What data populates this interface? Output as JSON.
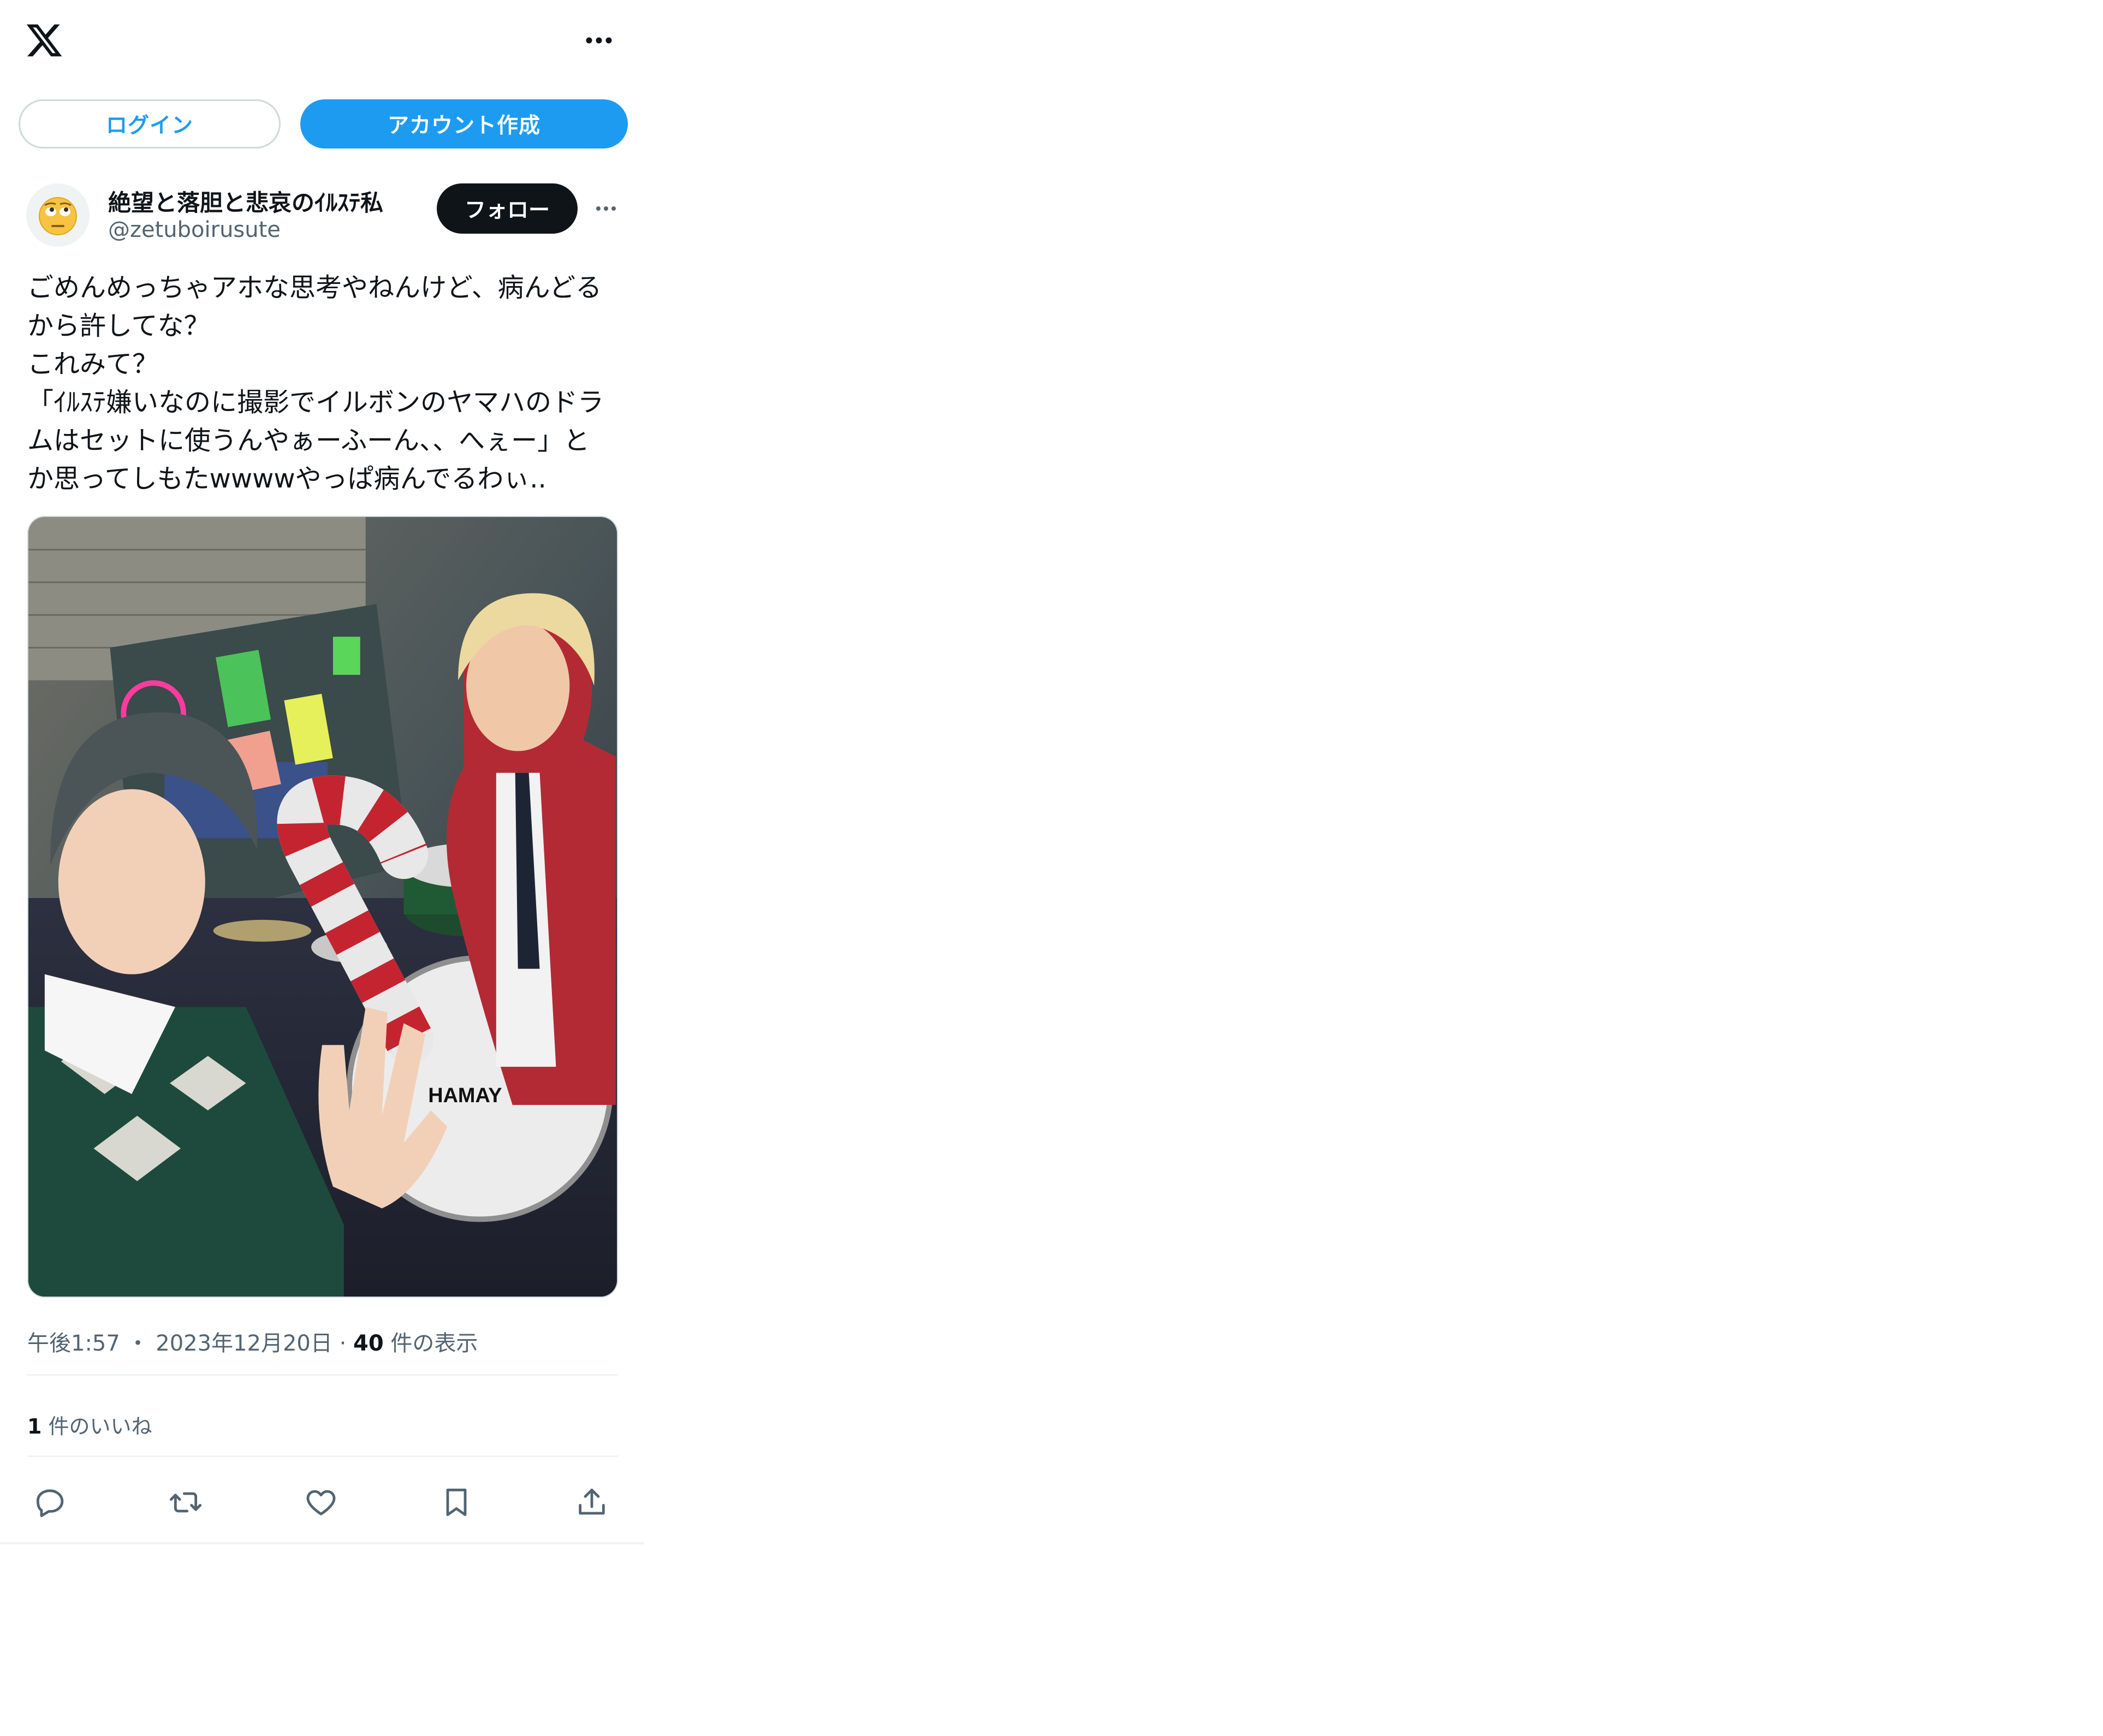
{
  "top_bar": {
    "logo_icon": "x-logo-icon",
    "more_icon": "more-horizontal-icon"
  },
  "auth": {
    "login_label": "ログイン",
    "signup_label": "アカウント作成"
  },
  "tweet": {
    "author_name": "絶望と落胆と悲哀のｲﾙｽﾃ私",
    "author_handle": "@zetuboirusute",
    "avatar_icon": "face-with-rolling-eyes-emoji",
    "follow_label": "フォロー",
    "text": "ごめんめっちゃアホな思考やねんけど、病んどる\nから許してな？\nこれみて？\n「ｲﾙｽﾃ嫌いなのに撮影でイルボンのヤマハのドラ\nムはセットに使うんやぁーふーん、、へぇー」と\nか思ってしもたwwwwやっぱ病んでるわぃ..",
    "photo_text": "HAMAY",
    "time": "午後1:57",
    "date": "2023年12月20日",
    "views_count": "40",
    "views_label": "件の表示",
    "likes_count": "1",
    "likes_label": "件のいいね"
  },
  "actions": [
    "reply-icon",
    "retweet-icon",
    "like-icon",
    "bookmark-icon",
    "share-icon"
  ],
  "colors": {
    "accent": "#1d9bf0",
    "text": "#0f1419",
    "secondary": "#536471",
    "border": "#cfd9de"
  }
}
